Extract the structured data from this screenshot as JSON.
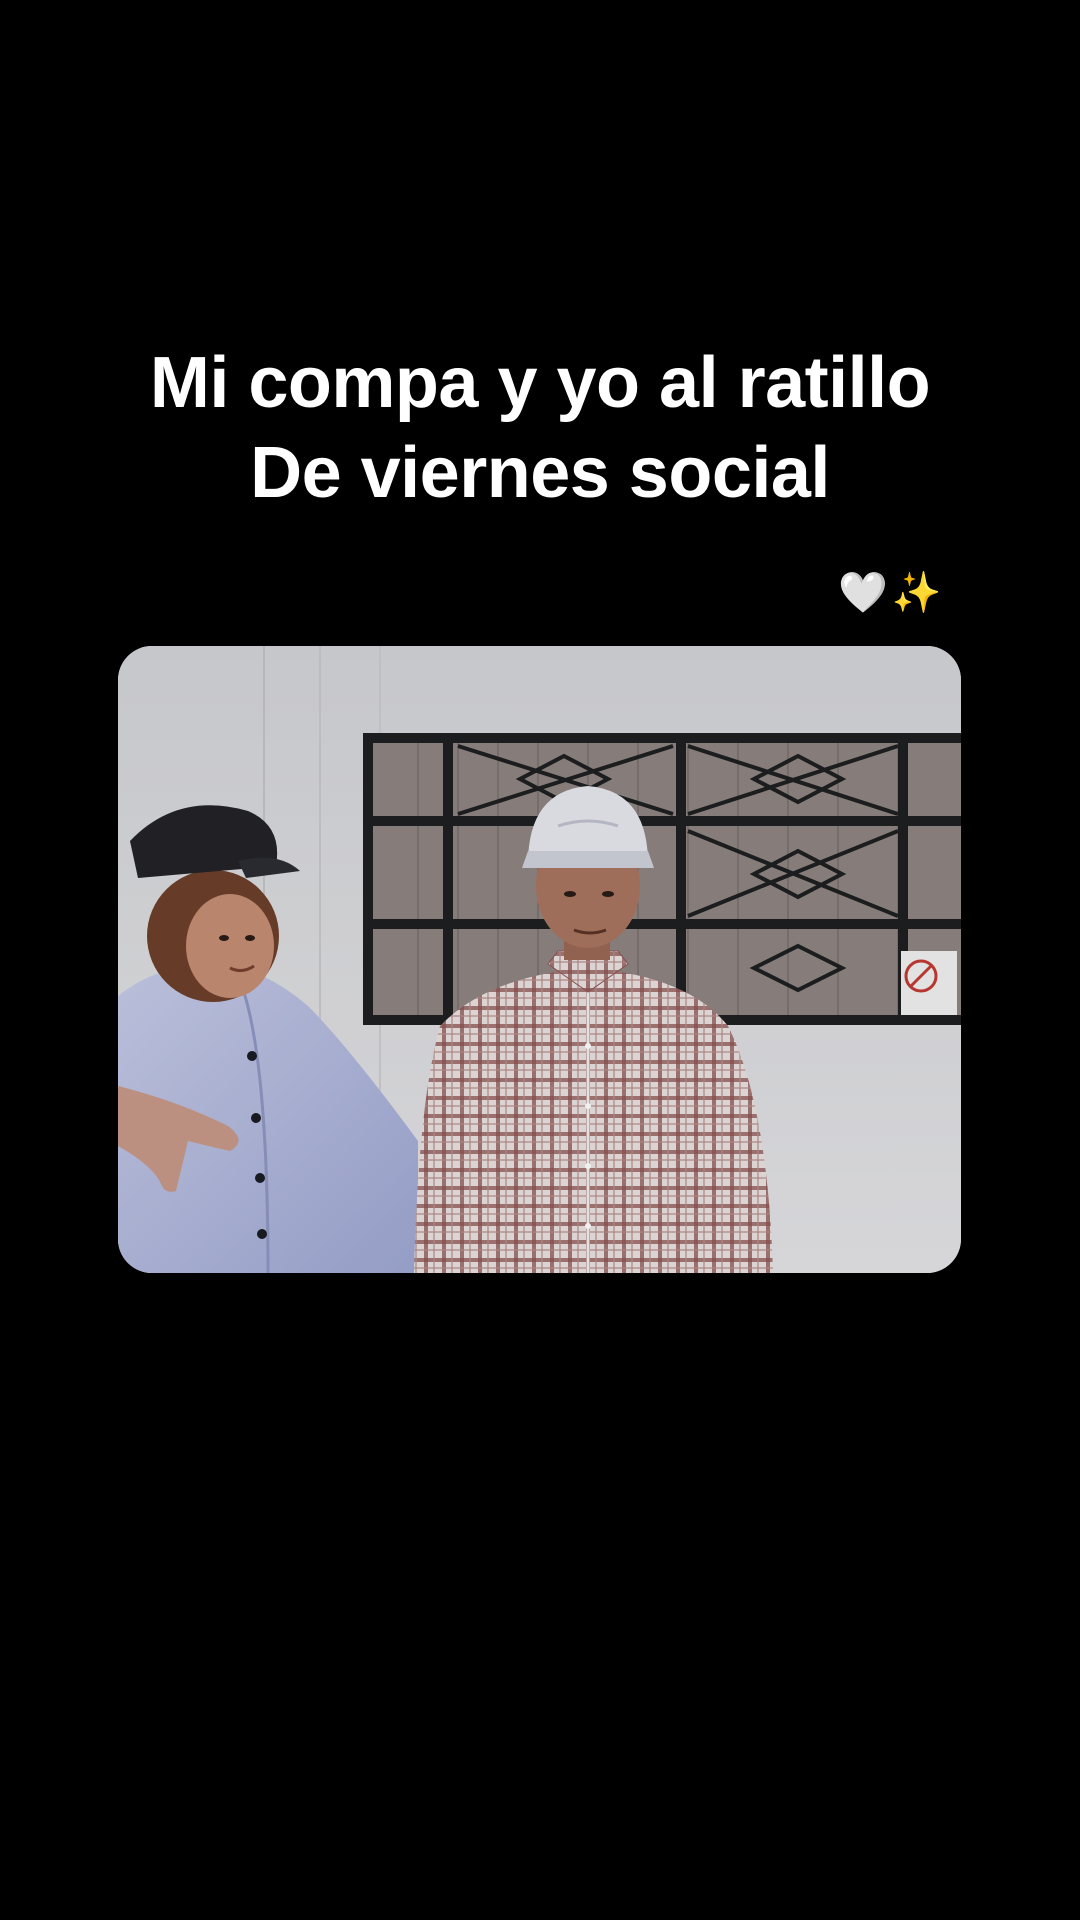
{
  "post": {
    "caption_line_1": "Mi compa y yo al ratillo",
    "caption_line_2": "De viernes social",
    "emoji_heart": "🤍",
    "emoji_sparkles": "✨"
  },
  "photo": {
    "description_icon": "photo-two-people-icon",
    "colors": {
      "wall": "#dcdcdf",
      "window_bars": "#1d1f20",
      "left_shirt": "#b7bedf",
      "right_shirt": "#9a6b66",
      "cap_dark": "#222328",
      "cap_light": "#e7e8ef"
    }
  }
}
